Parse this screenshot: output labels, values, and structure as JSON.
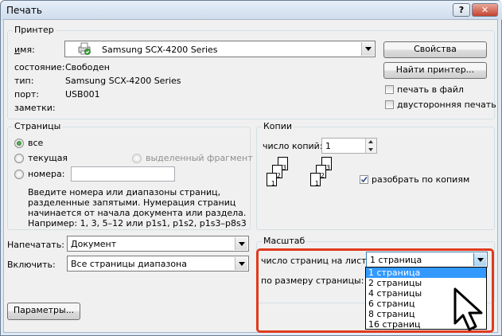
{
  "window": {
    "title": "Печать",
    "help_glyph": "?",
    "close_glyph": "✕"
  },
  "printer": {
    "group_title": "Принтер",
    "name_label": "имя:",
    "name_value": "Samsung SCX-4200 Series",
    "status_label": "состояние:",
    "status_value": "Свободен",
    "type_label": "тип:",
    "type_value": "Samsung SCX-4200 Series",
    "port_label": "порт:",
    "port_value": "USB001",
    "notes_label": "заметки:",
    "properties_button": "Свойства",
    "find_printer_button": "Найти принтер...",
    "print_to_file_label": "печать в файл",
    "print_to_file_checked": false,
    "duplex_label": "двусторонняя печать",
    "duplex_checked": false
  },
  "pages": {
    "group_title": "Страницы",
    "all_label": "все",
    "current_label": "текущая",
    "selection_label": "выделенный фрагмент",
    "numbers_label": "номера:",
    "numbers_value": "",
    "selected_option": "all",
    "hint_lines": [
      "Введите номера или диапазоны страниц,",
      "разделенные запятыми. Нумерация страниц",
      "начинается от начала документа или раздела.",
      "Например: 1, 3, 5–12 или p1s1, p1s2, p1s3–p8s3"
    ]
  },
  "print_what": {
    "label": "Напечатать:",
    "value": "Документ"
  },
  "include": {
    "label": "Включить:",
    "value": "Все страницы диапазона"
  },
  "copies": {
    "group_title": "Копии",
    "count_label": "число копий:",
    "count_value": "1",
    "collate_label": "разобрать по копиям",
    "collate_checked": true,
    "stack_page_numbers": [
      "1",
      "2",
      "3"
    ]
  },
  "scale": {
    "group_title": "Масштаб",
    "pages_per_sheet_label": "число страниц на листе:",
    "pages_per_sheet_value": "1 страница",
    "scale_to_paper_label": "по размеру страницы:",
    "options": [
      "1 страница",
      "2 страницы",
      "4 страницы",
      "6 страниц",
      "8 страниц",
      "16 страниц"
    ],
    "selected_index": 0
  },
  "options_button": "Параметры...",
  "colors": {
    "highlight": "#e03a1e",
    "selection": "#3399ff"
  }
}
